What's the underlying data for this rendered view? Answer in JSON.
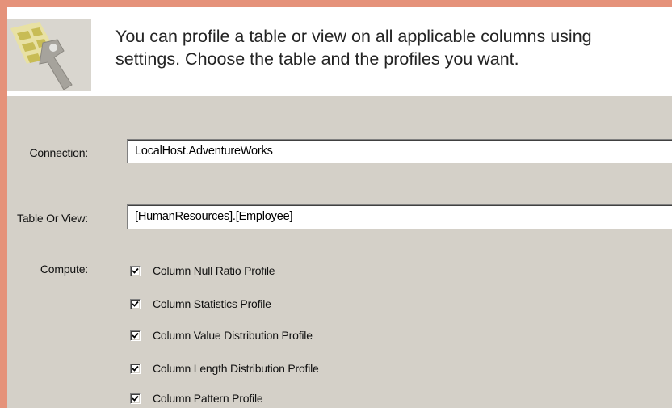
{
  "header": {
    "description_line1": "You can profile a table or view on all applicable columns using",
    "description_line2": "settings. Choose the table and the profiles you want."
  },
  "form": {
    "connection_label": "Connection:",
    "connection_value": "LocalHost.AdventureWorks",
    "table_label": "Table Or View:",
    "table_value": "[HumanResources].[Employee]",
    "compute_label": "Compute:"
  },
  "profiles": [
    {
      "label": "Column Null Ratio Profile",
      "checked": true
    },
    {
      "label": "Column Statistics Profile",
      "checked": true
    },
    {
      "label": "Column Value Distribution Profile",
      "checked": true
    },
    {
      "label": "Column Length Distribution Profile",
      "checked": true
    },
    {
      "label": "Column Pattern Profile",
      "checked": true
    }
  ],
  "colors": {
    "outer_border": "#e5927a",
    "dialog_background": "#d4d0c8",
    "header_background": "#ffffff"
  },
  "icons": {
    "wizard_icon": "table-wrench-icon",
    "dropdown_icon": "chevron-down-icon",
    "check_icon": "checkmark-icon"
  }
}
